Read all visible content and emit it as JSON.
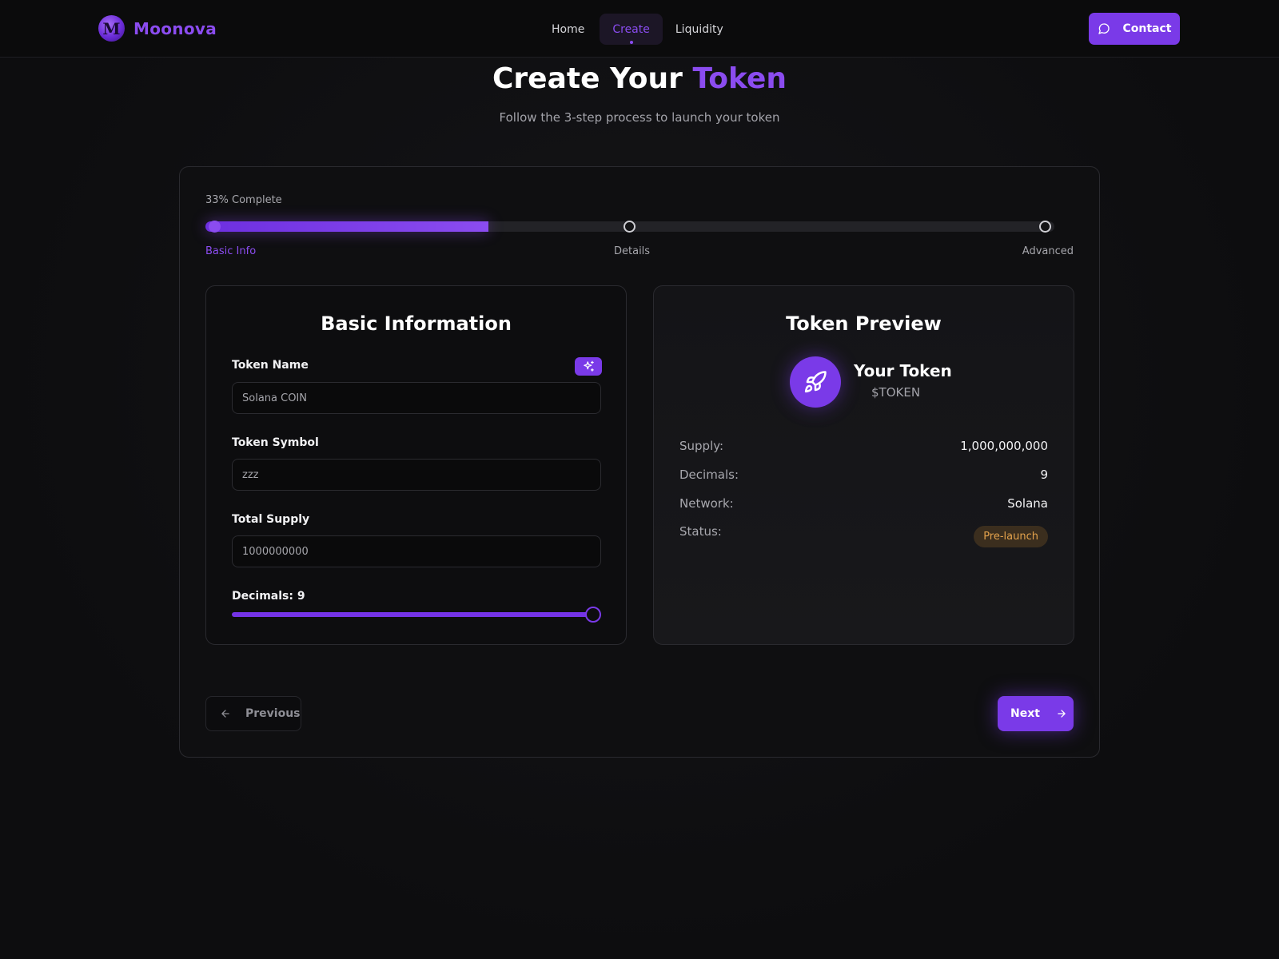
{
  "nav": {
    "logo_letter": "M",
    "brand": "Moonova",
    "links": [
      {
        "label": "Home",
        "active": false
      },
      {
        "label": "Create",
        "active": true
      },
      {
        "label": "Liquidity",
        "active": false
      }
    ],
    "contact_label": "Contact",
    "contact_icon": "message-circle-icon"
  },
  "header": {
    "title_prefix": "Create Your",
    "title_accent": "Token",
    "subtitle": "Follow the 3-step process to launch your token"
  },
  "progress": {
    "label": "33% Complete",
    "percent": 33.3,
    "steps": [
      {
        "label": "Basic Info",
        "active": true
      },
      {
        "label": "Details",
        "active": false
      },
      {
        "label": "Advanced",
        "active": false
      }
    ]
  },
  "form": {
    "title": "Basic Information",
    "token_name_label": "Token Name",
    "token_name_value": "Solana COIN",
    "magic_icon": "sparkles-icon",
    "token_symbol_label": "Token Symbol",
    "token_symbol_value": "zzz",
    "total_supply_label": "Total Supply",
    "total_supply_value": "1000000000",
    "decimals_label": "Decimals: 9",
    "decimals_value": 9,
    "decimals_max": 9
  },
  "preview": {
    "title": "Token Preview",
    "icon": "rocket-icon",
    "token_name": "Your Token",
    "token_symbol": "$TOKEN",
    "supply_label": "Supply:",
    "supply_value": "1,000,000,000",
    "decimals_label": "Decimals:",
    "decimals_value": "9",
    "network_label": "Network:",
    "network_value": "Solana",
    "status_label": "Status:",
    "status_value": "Pre-launch"
  },
  "footer": {
    "previous_label": "Previous",
    "next_label": "Next"
  },
  "colors": {
    "accent": "#8b4cf0",
    "button": "#7a3ae8",
    "status_badge_text": "#e3a24c",
    "background": "#0e0e10"
  }
}
